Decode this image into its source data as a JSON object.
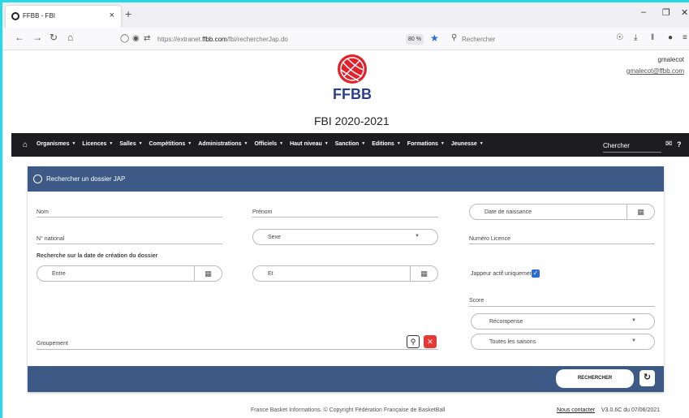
{
  "browser": {
    "tab_title": "FFBB - FBI",
    "tab_close": "×",
    "new_tab": "+",
    "url_prefix": "https://extranet.",
    "url_domain": "ffbb.com",
    "url_path": "/fbi/rechercherJap.do",
    "zoom": "80 %",
    "search_placeholder": "Rechercher"
  },
  "user": {
    "login": "gmalecot",
    "email": "gmalecot@ffbb.com"
  },
  "brand": {
    "logo_text": "FFBB",
    "page_title": "FBI 2020-2021",
    "logo_color": "#e2212a"
  },
  "menu": {
    "items": [
      {
        "label": "Organismes"
      },
      {
        "label": "Licences"
      },
      {
        "label": "Salles"
      },
      {
        "label": "Compétitions"
      },
      {
        "label": "Administrations"
      },
      {
        "label": "Officiels"
      },
      {
        "label": "Haut niveau"
      },
      {
        "label": "Sanction"
      },
      {
        "label": "Editions"
      },
      {
        "label": "Formations"
      },
      {
        "label": "Jeunesse"
      }
    ],
    "search_label": "Chercher",
    "help": "?"
  },
  "panel": {
    "title": "Rechercher un dossier JAP",
    "header_color": "#3d5a86",
    "fields": {
      "nom": "Nom",
      "prenom": "Prénom",
      "date_naissance": "Date de naissance",
      "numero_national": "N° national",
      "sexe": "Sexe",
      "numero_licence": "Numéro Licence",
      "date_creation_title": "Recherche sur la date de création du dossier",
      "entre": "Entre",
      "et": "Et",
      "jappeur": "Jappeur actif uniquement",
      "score": "Score",
      "recompense": "Récompense",
      "saisons": "Toutes les saisons",
      "groupement": "Groupement"
    },
    "submit_label": "RECHERCHER"
  },
  "footer": {
    "copyright": "France Basket Informations. © Copyright Fédération Française de BasketBall",
    "contact": "Nous contacter",
    "version": "V3.0.6C du 07/06/2021"
  }
}
